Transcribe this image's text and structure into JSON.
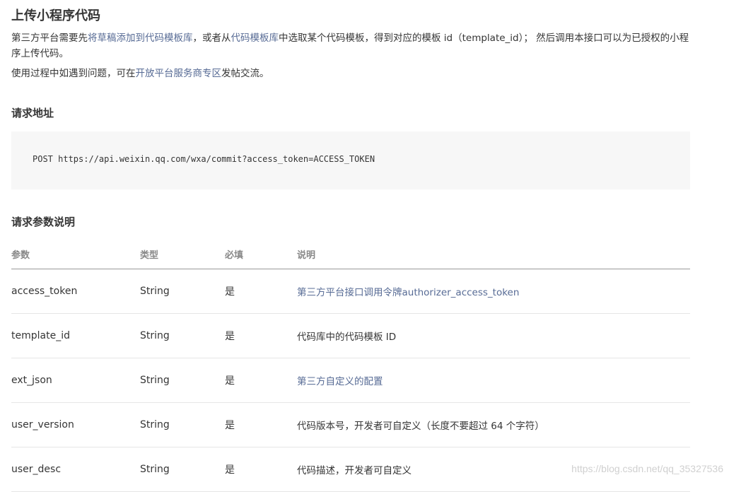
{
  "title": "上传小程序代码",
  "intro": {
    "p1_a": "第三方平台需要先",
    "p1_link1": "将草稿添加到代码模板库",
    "p1_b": "，或者从",
    "p1_link2": "代码模板库",
    "p1_c": "中选取某个代码模板，得到对应的模板 id（template_id）； 然后调用本接口可以为已授权的小程序上传代码。",
    "p2_a": "使用过程中如遇到问题，可在",
    "p2_link": "开放平台服务商专区",
    "p2_b": "发帖交流。"
  },
  "request_url": {
    "heading": "请求地址",
    "code": "POST https://api.weixin.qq.com/wxa/commit?access_token=ACCESS_TOKEN"
  },
  "params": {
    "heading": "请求参数说明",
    "columns": [
      "参数",
      "类型",
      "必填",
      "说明"
    ],
    "rows": [
      {
        "name": "access_token",
        "type": "String",
        "required": "是",
        "desc": "第三方平台接口调用令牌authorizer_access_token",
        "is_link": true
      },
      {
        "name": "template_id",
        "type": "String",
        "required": "是",
        "desc": "代码库中的代码模板 ID",
        "is_link": false
      },
      {
        "name": "ext_json",
        "type": "String",
        "required": "是",
        "desc": "第三方自定义的配置",
        "is_link": true
      },
      {
        "name": "user_version",
        "type": "String",
        "required": "是",
        "desc": "代码版本号，开发者可自定义（长度不要超过 64 个字符）",
        "is_link": false
      },
      {
        "name": "user_desc",
        "type": "String",
        "required": "是",
        "desc": "代码描述，开发者可自定义",
        "is_link": false
      }
    ]
  },
  "watermark": "https://blog.csdn.net/qq_35327536",
  "colors": {
    "link": "#576b95",
    "text": "#353535",
    "code_bg": "#f7f7f7"
  }
}
